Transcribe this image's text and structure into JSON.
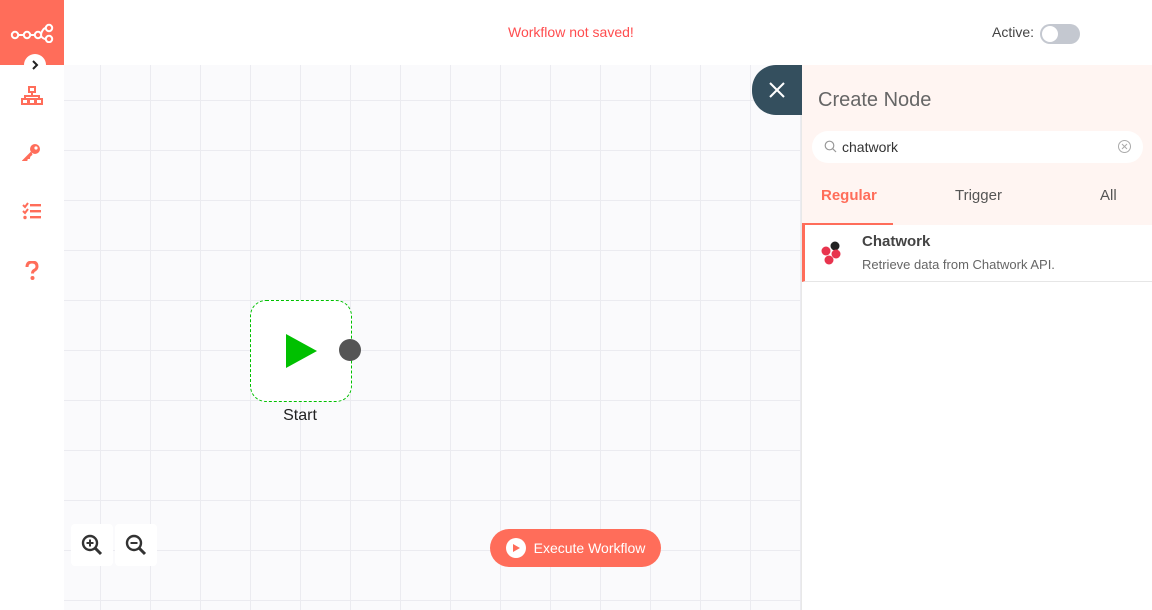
{
  "header": {
    "save_status": "Workflow not saved!",
    "active_label": "Active:",
    "active": false
  },
  "sidebar": {
    "items": [
      {
        "name": "workflow-icon"
      },
      {
        "name": "key-icon"
      },
      {
        "name": "tasks-icon"
      },
      {
        "name": "help-icon"
      }
    ]
  },
  "canvas": {
    "start_node_label": "Start",
    "execute_button_label": "Execute Workflow"
  },
  "panel": {
    "title": "Create Node",
    "search": {
      "value": "chatwork",
      "placeholder": ""
    },
    "tabs": [
      {
        "label": "Regular",
        "active": true
      },
      {
        "label": "Trigger",
        "active": false
      },
      {
        "label": "All",
        "active": false
      }
    ],
    "results": [
      {
        "name": "Chatwork",
        "description": "Retrieve data from Chatwork API."
      }
    ]
  },
  "colors": {
    "accent": "#ff6d5a",
    "error": "#ff4d4f",
    "close_tab": "#344f5e",
    "start_green": "#00c000"
  }
}
